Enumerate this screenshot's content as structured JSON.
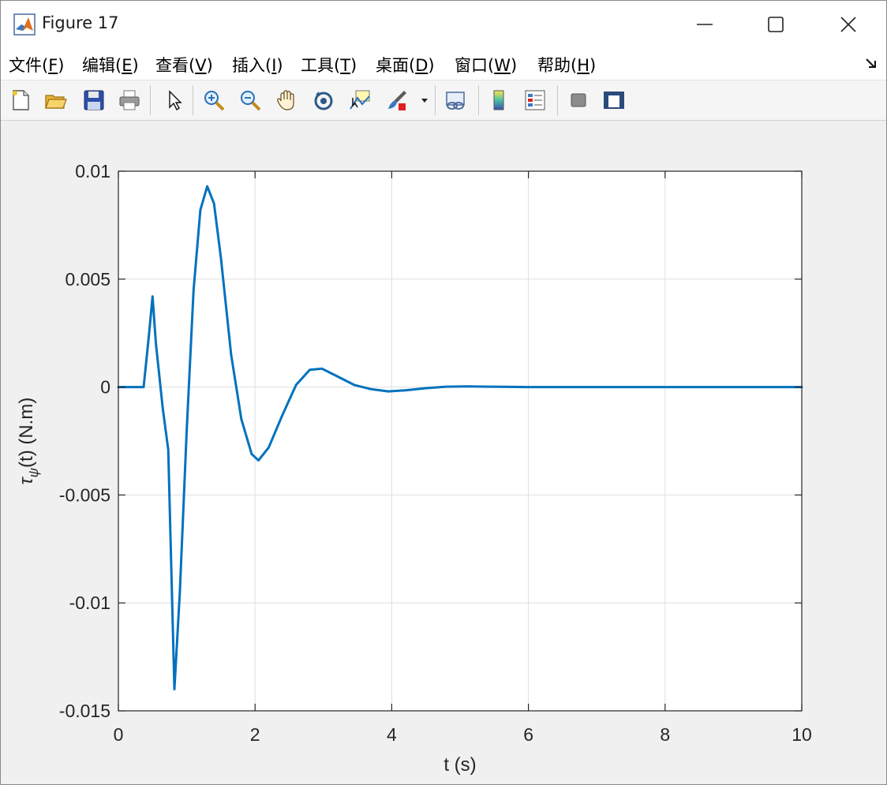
{
  "window": {
    "title": "Figure 17",
    "icons": {
      "app": "matlab-logo-icon",
      "minimize": "minimize-icon",
      "maximize": "maximize-icon",
      "close": "close-icon"
    }
  },
  "menubar": {
    "items": [
      {
        "prefix": "文件(",
        "key": "F",
        "suffix": ")"
      },
      {
        "prefix": "编辑(",
        "key": "E",
        "suffix": ")"
      },
      {
        "prefix": "查看(",
        "key": "V",
        "suffix": ")"
      },
      {
        "prefix": "插入(",
        "key": "I",
        "suffix": ")"
      },
      {
        "prefix": "工具(",
        "key": "T",
        "suffix": ")"
      },
      {
        "prefix": "桌面(",
        "key": "D",
        "suffix": ")"
      },
      {
        "prefix": "窗口(",
        "key": "W",
        "suffix": ")"
      },
      {
        "prefix": "帮助(",
        "key": "H",
        "suffix": ")"
      }
    ],
    "dock_icon": "dock-arrow-icon"
  },
  "toolbar": {
    "icons": [
      "new-figure-icon",
      "open-file-icon",
      "save-icon",
      "print-icon",
      "edit-plot-arrow-icon",
      "zoom-in-icon",
      "zoom-out-icon",
      "pan-hand-icon",
      "rotate-3d-icon",
      "data-cursor-icon",
      "brush-icon",
      "brush-dropdown-icon",
      "link-plot-icon",
      "colorbar-icon",
      "legend-icon",
      "hide-plot-tools-icon",
      "show-plot-tools-icon"
    ]
  },
  "chart_data": {
    "type": "line",
    "xlabel": "t (s)",
    "ylabel_main": "τ",
    "ylabel_sub": "ψ",
    "ylabel_rest": "(t) (N.m)",
    "xlim": [
      0,
      10
    ],
    "ylim": [
      -0.015,
      0.01
    ],
    "xticks": [
      0,
      2,
      4,
      6,
      8,
      10
    ],
    "xtick_labels": [
      "0",
      "2",
      "4",
      "6",
      "8",
      "10"
    ],
    "yticks": [
      -0.015,
      -0.01,
      -0.005,
      0,
      0.005,
      0.01
    ],
    "ytick_labels": [
      "-0.015",
      "-0.01",
      "-0.005",
      "0",
      "0.005",
      "0.01"
    ],
    "grid": true,
    "series": [
      {
        "color": "#0072bd",
        "x": [
          0,
          0.37,
          0.45,
          0.5,
          0.55,
          0.65,
          0.73,
          0.82,
          0.9,
          1.0,
          1.1,
          1.2,
          1.3,
          1.4,
          1.5,
          1.65,
          1.8,
          1.95,
          2.05,
          2.2,
          2.4,
          2.6,
          2.8,
          2.98,
          3.2,
          3.45,
          3.7,
          3.95,
          4.2,
          4.5,
          4.8,
          5.1,
          5.4,
          6,
          7,
          8,
          9,
          10
        ],
        "y": [
          0,
          0,
          0.0025,
          0.0042,
          0.002,
          -0.001,
          -0.0029,
          -0.014,
          -0.0095,
          -0.002,
          0.0045,
          0.0082,
          0.0093,
          0.0085,
          0.006,
          0.0015,
          -0.0015,
          -0.0031,
          -0.0034,
          -0.0028,
          -0.0013,
          0.0001,
          0.0008,
          0.00085,
          0.0005,
          0.0001,
          -0.0001,
          -0.0002,
          -0.00015,
          -5e-05,
          2e-05,
          3e-05,
          2e-05,
          0,
          0,
          0,
          0,
          0
        ]
      }
    ]
  }
}
